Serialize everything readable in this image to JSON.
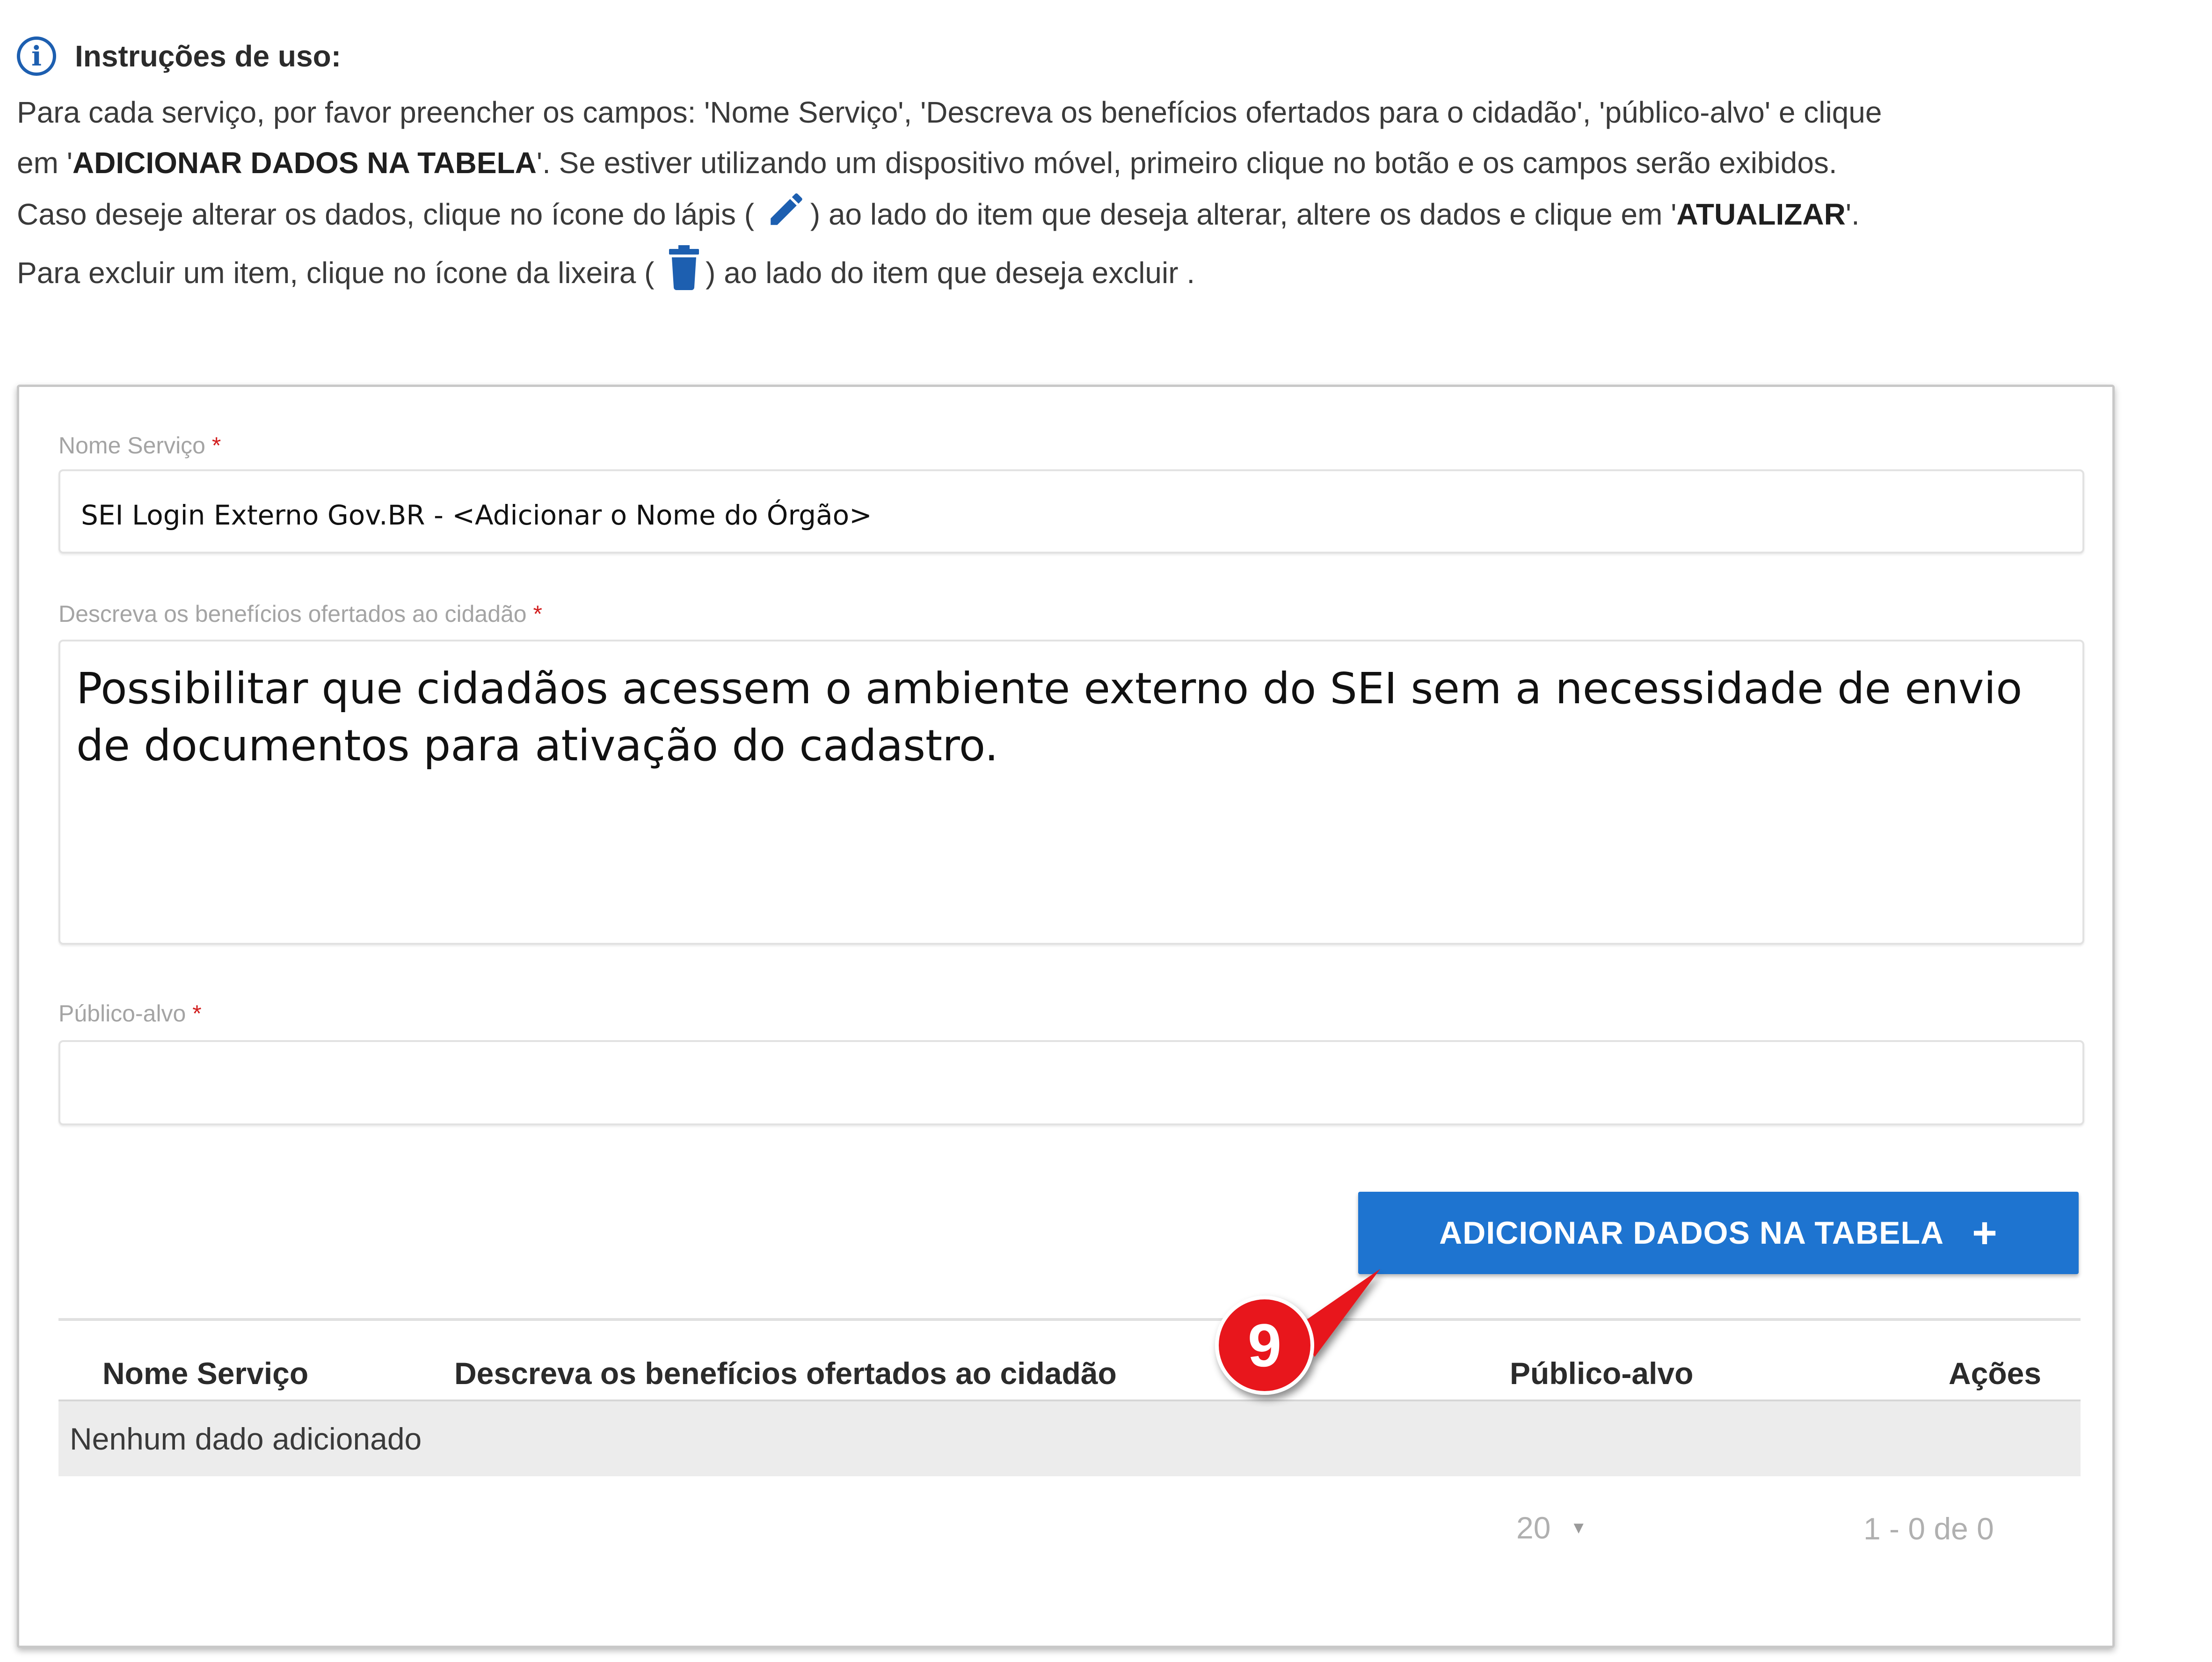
{
  "instructions": {
    "title": "Instruções de uso:",
    "line1": "Para cada serviço, por favor preencher os campos: 'Nome Serviço', 'Descreva os benefícios ofertados para o cidadão', 'público-alvo' e clique",
    "line2_pre": "em '",
    "line2_bold": "ADICIONAR DADOS NA TABELA",
    "line2_post": "'. Se estiver utilizando um dispositivo móvel, primeiro clique no botão e os campos serão exibidos.",
    "line3_pre": "Caso deseje alterar os dados, clique no ícone do lápis (",
    "line3_mid": ") ao lado do item que deseja alterar, altere os dados e clique em '",
    "line3_bold": "ATUALIZAR",
    "line3_post": "'.",
    "line4_pre": "Para excluir um item, clique no ícone da lixeira (",
    "line4_post": ") ao lado do item que deseja excluir ."
  },
  "form": {
    "nome_servico": {
      "label": "Nome Serviço",
      "required_mark": "*",
      "value": "SEI Login Externo Gov.BR - <Adicionar o Nome do Órgão>"
    },
    "beneficios": {
      "label": "Descreva os benefícios ofertados ao cidadão",
      "required_mark": "*",
      "value": "Possibilitar que cidadãos acessem o ambiente externo do SEI sem a necessidade de envio de documentos para ativação do cadastro."
    },
    "publico_alvo": {
      "label": "Público-alvo",
      "required_mark": "*",
      "value": ""
    },
    "add_button_label": "ADICIONAR DADOS NA TABELA",
    "add_button_icon": "plus-icon"
  },
  "table": {
    "columns": [
      "Nome Serviço",
      "Descreva os benefícios ofertados ao cidadão",
      "Público-alvo",
      "Ações"
    ],
    "empty_message": "Nenhum dado adicionado",
    "page_size": "20",
    "range": "1 - 0 de 0"
  },
  "annotation": {
    "step_number": "9"
  },
  "colors": {
    "primary": "#1e74d0",
    "info_icon": "#1d5fb0",
    "required": "#d21f1f",
    "marker": "#e8141a"
  }
}
